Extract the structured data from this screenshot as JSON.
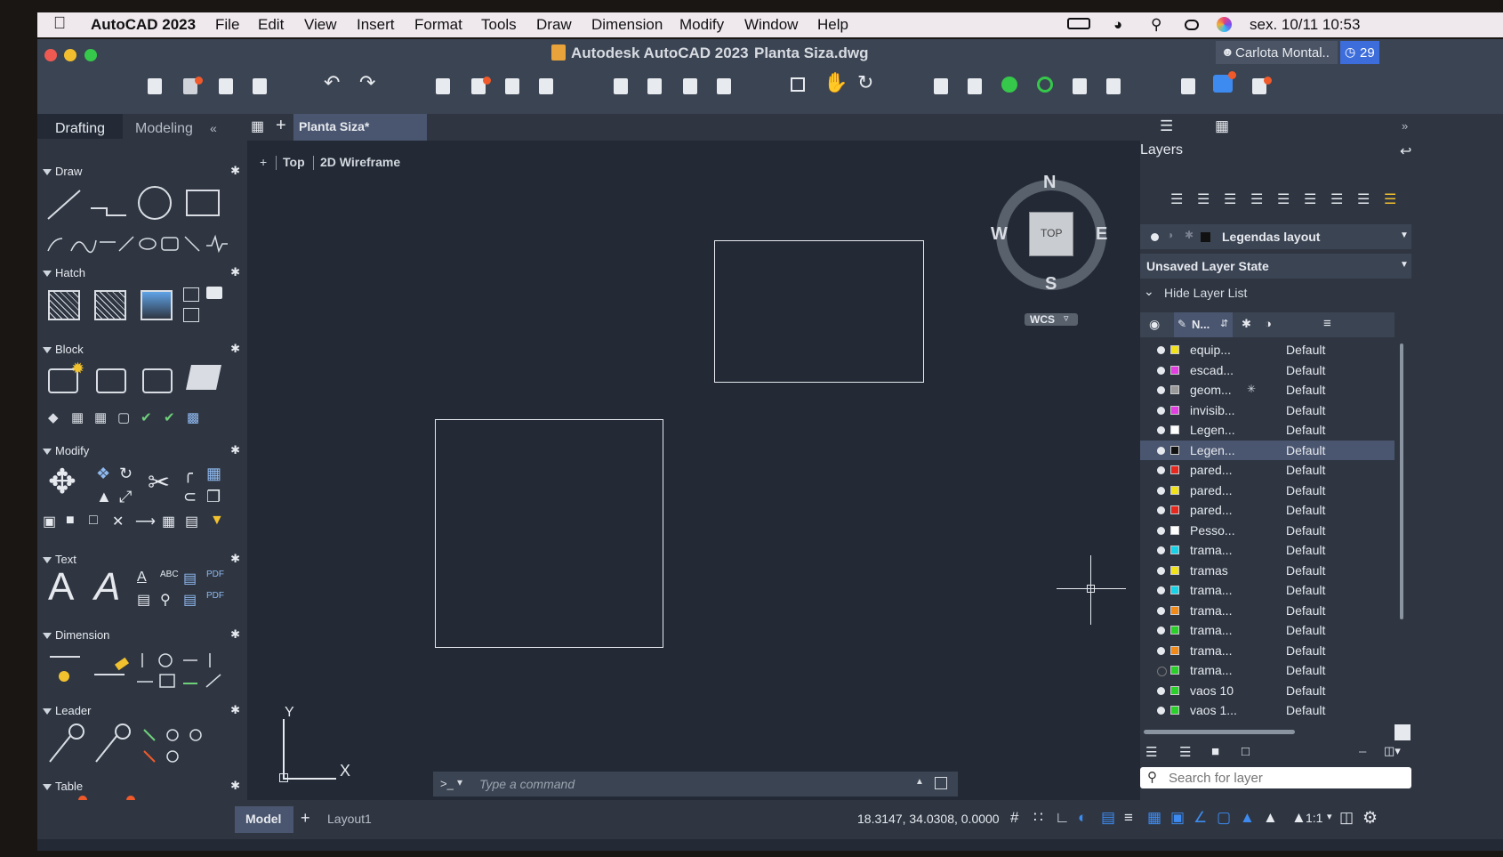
{
  "menubar": {
    "app_name": "AutoCAD 2023",
    "items": [
      "File",
      "Edit",
      "View",
      "Insert",
      "Format",
      "Tools",
      "Draw",
      "Dimension",
      "Modify",
      "Window",
      "Help"
    ],
    "datetime": "sex. 10/11  10:53"
  },
  "window": {
    "title": "Autodesk AutoCAD 2023",
    "filename": "Planta Siza.dwg",
    "user": "Carlota Montal..",
    "notifications": "29"
  },
  "palette": {
    "tabs": [
      "Drafting",
      "Modeling"
    ],
    "collapse": "«",
    "sections": [
      "Draw",
      "Hatch",
      "Block",
      "Modify",
      "Text",
      "Dimension",
      "Leader",
      "Table"
    ]
  },
  "canvas": {
    "doc_tab": "Planta Siza*",
    "viewport": {
      "plus": "+",
      "view": "Top",
      "style": "2D Wireframe"
    },
    "viewcube": {
      "n": "N",
      "s": "S",
      "e": "E",
      "w": "W",
      "top": "TOP",
      "wcs": "WCS"
    },
    "ucs": {
      "x": "X",
      "y": "Y"
    },
    "command_prompt": "Type a command",
    "command_icon": ">_"
  },
  "layers": {
    "title": "Layers",
    "current_layer": "Legendas layout",
    "layer_state": "Unsaved Layer State",
    "hide_list": "Hide Layer List",
    "name_col": "N...",
    "search_placeholder": "Search for layer",
    "rows": [
      {
        "name": "equip...",
        "color": "#f2e21a",
        "desc": "Default"
      },
      {
        "name": "escad...",
        "color": "#e23ee2",
        "desc": "Default"
      },
      {
        "name": "geom...",
        "color": "#9a9a9a",
        "desc": "Default"
      },
      {
        "name": "invisib...",
        "color": "#e23ee2",
        "desc": "Default"
      },
      {
        "name": "Legen...",
        "color": "#ffffff",
        "desc": "Default"
      },
      {
        "name": "Legen...",
        "color": "#111111",
        "desc": "Default"
      },
      {
        "name": "pared...",
        "color": "#e8271f",
        "desc": "Default"
      },
      {
        "name": "pared...",
        "color": "#f2e21a",
        "desc": "Default"
      },
      {
        "name": "pared...",
        "color": "#e8271f",
        "desc": "Default"
      },
      {
        "name": "Pesso...",
        "color": "#ffffff",
        "desc": "Default"
      },
      {
        "name": "trama...",
        "color": "#17d3e8",
        "desc": "Default"
      },
      {
        "name": "tramas",
        "color": "#f2e21a",
        "desc": "Default"
      },
      {
        "name": "trama...",
        "color": "#17d3e8",
        "desc": "Default"
      },
      {
        "name": "trama...",
        "color": "#f28a1a",
        "desc": "Default"
      },
      {
        "name": "trama...",
        "color": "#2ad12a",
        "desc": "Default"
      },
      {
        "name": "trama...",
        "color": "#f28a1a",
        "desc": "Default"
      },
      {
        "name": "trama...",
        "color": "#2ad12a",
        "desc": "Default"
      },
      {
        "name": "vaos 10",
        "color": "#2ad12a",
        "desc": "Default"
      },
      {
        "name": "vaos 1...",
        "color": "#2ad12a",
        "desc": "Default"
      }
    ],
    "dash": "–"
  },
  "statusbar": {
    "model_tab": "Model",
    "layout_tab": "Layout1",
    "coords": "18.3147, 34.0308, 0.0000",
    "scale": "1:1"
  },
  "colors": {
    "bg": "#232a36",
    "panel": "#2f3642",
    "toolbar": "#3b4453",
    "accent": "#3d6ddb",
    "selection": "#4a5670"
  }
}
